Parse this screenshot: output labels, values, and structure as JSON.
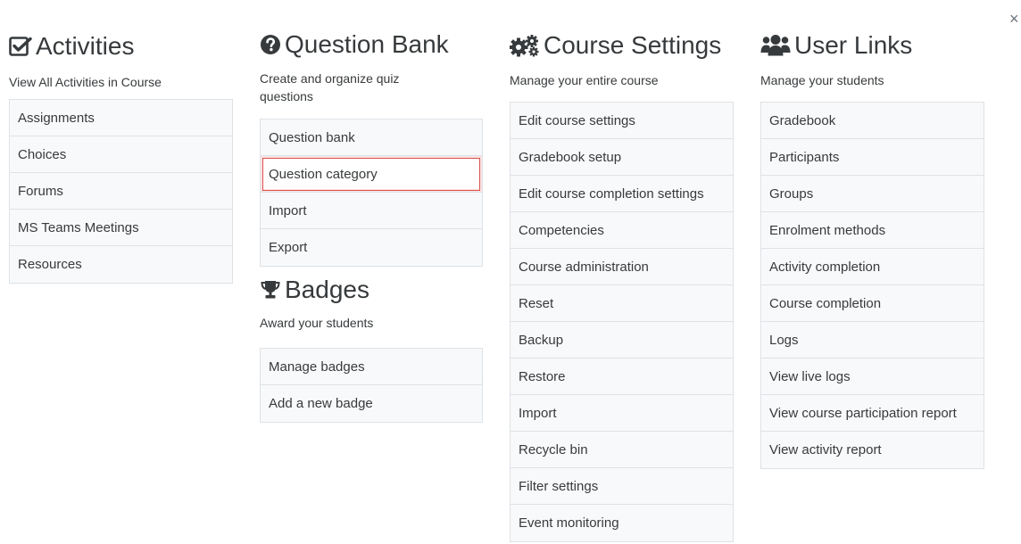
{
  "close_label": "×",
  "activities": {
    "title": "Activities",
    "icon": "check-square-icon",
    "description": "View All Activities in Course",
    "items": [
      "Assignments",
      "Choices",
      "Forums",
      "MS Teams Meetings",
      "Resources"
    ]
  },
  "question_bank": {
    "title": "Question Bank",
    "icon": "question-circle-icon",
    "description": "Create and organize quiz questions",
    "items": [
      "Question bank",
      "Question category",
      "Import",
      "Export"
    ],
    "focused_item": "Question category"
  },
  "badges": {
    "title": "Badges",
    "icon": "trophy-icon",
    "description": "Award your students",
    "items": [
      "Manage badges",
      "Add a new badge"
    ]
  },
  "course_settings": {
    "title": "Course Settings",
    "icon": "cogs-icon",
    "description": "Manage your entire course",
    "items": [
      "Edit course settings",
      "Gradebook setup",
      "Edit course completion settings",
      "Competencies",
      "Course administration",
      "Reset",
      "Backup",
      "Restore",
      "Import",
      "Recycle bin",
      "Filter settings",
      "Event monitoring"
    ]
  },
  "user_links": {
    "title": "User Links",
    "icon": "users-icon",
    "description": "Manage your students",
    "items": [
      "Gradebook",
      "Participants",
      "Groups",
      "Enrolment methods",
      "Activity completion",
      "Course completion",
      "Logs",
      "View live logs",
      "View course participation report",
      "View activity report"
    ]
  }
}
